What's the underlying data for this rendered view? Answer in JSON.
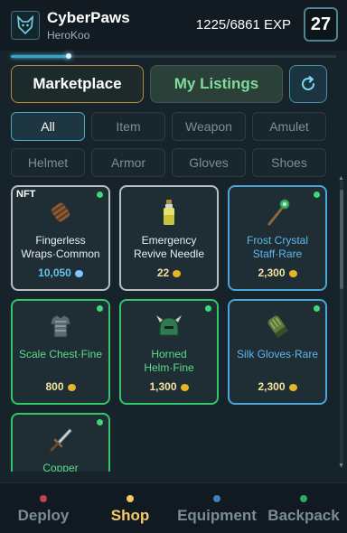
{
  "header": {
    "title": "CyberPaws",
    "username": "HeroKoo",
    "exp_text": "1225/6861 EXP",
    "exp_fraction": 0.178,
    "level": "27",
    "logo_icon": "cat-head-icon"
  },
  "tabs": {
    "marketplace": "Marketplace",
    "my_listings": "My Listings",
    "refresh_icon": "refresh-icon"
  },
  "filters": [
    "All",
    "Item",
    "Weapon",
    "Amulet",
    "Helmet",
    "Armor",
    "Gloves",
    "Shoes"
  ],
  "items": [
    {
      "name": "Fingerless Wraps·Common",
      "price": "10,050",
      "nft": "NFT",
      "currency": "gem-icon",
      "icon": "wraps-icon"
    },
    {
      "name": "Emergency Revive Needle",
      "price": "22",
      "currency": "coin-icon",
      "icon": "potion-icon"
    },
    {
      "name": "Frost Crystal Staff·Rare",
      "price": "2,300",
      "currency": "coin-icon",
      "icon": "staff-icon"
    },
    {
      "name": "Scale Chest·Fine",
      "price": "800",
      "currency": "coin-icon",
      "icon": "chest-armor-icon"
    },
    {
      "name": "Horned Helm·Fine",
      "price": "1,300",
      "currency": "coin-icon",
      "icon": "helmet-icon"
    },
    {
      "name": "Silk Gloves·Rare",
      "price": "2,300",
      "currency": "coin-icon",
      "icon": "gloves-icon"
    },
    {
      "name": "Copper",
      "price": "",
      "currency": "coin-icon",
      "icon": "dagger-icon"
    }
  ],
  "nav": [
    {
      "label": "Deploy",
      "dot_color": "#c0414f"
    },
    {
      "label": "Shop",
      "dot_color": "#f6c86a"
    },
    {
      "label": "Equipment",
      "dot_color": "#3b7fc0"
    },
    {
      "label": "Backpack",
      "dot_color": "#3ba36a"
    }
  ],
  "colors": {
    "rarity_common": "#b7c0c6",
    "rarity_rare": "#4aa6d8",
    "rarity_fine": "#34c46a",
    "accent_gold": "#f6c86a"
  }
}
